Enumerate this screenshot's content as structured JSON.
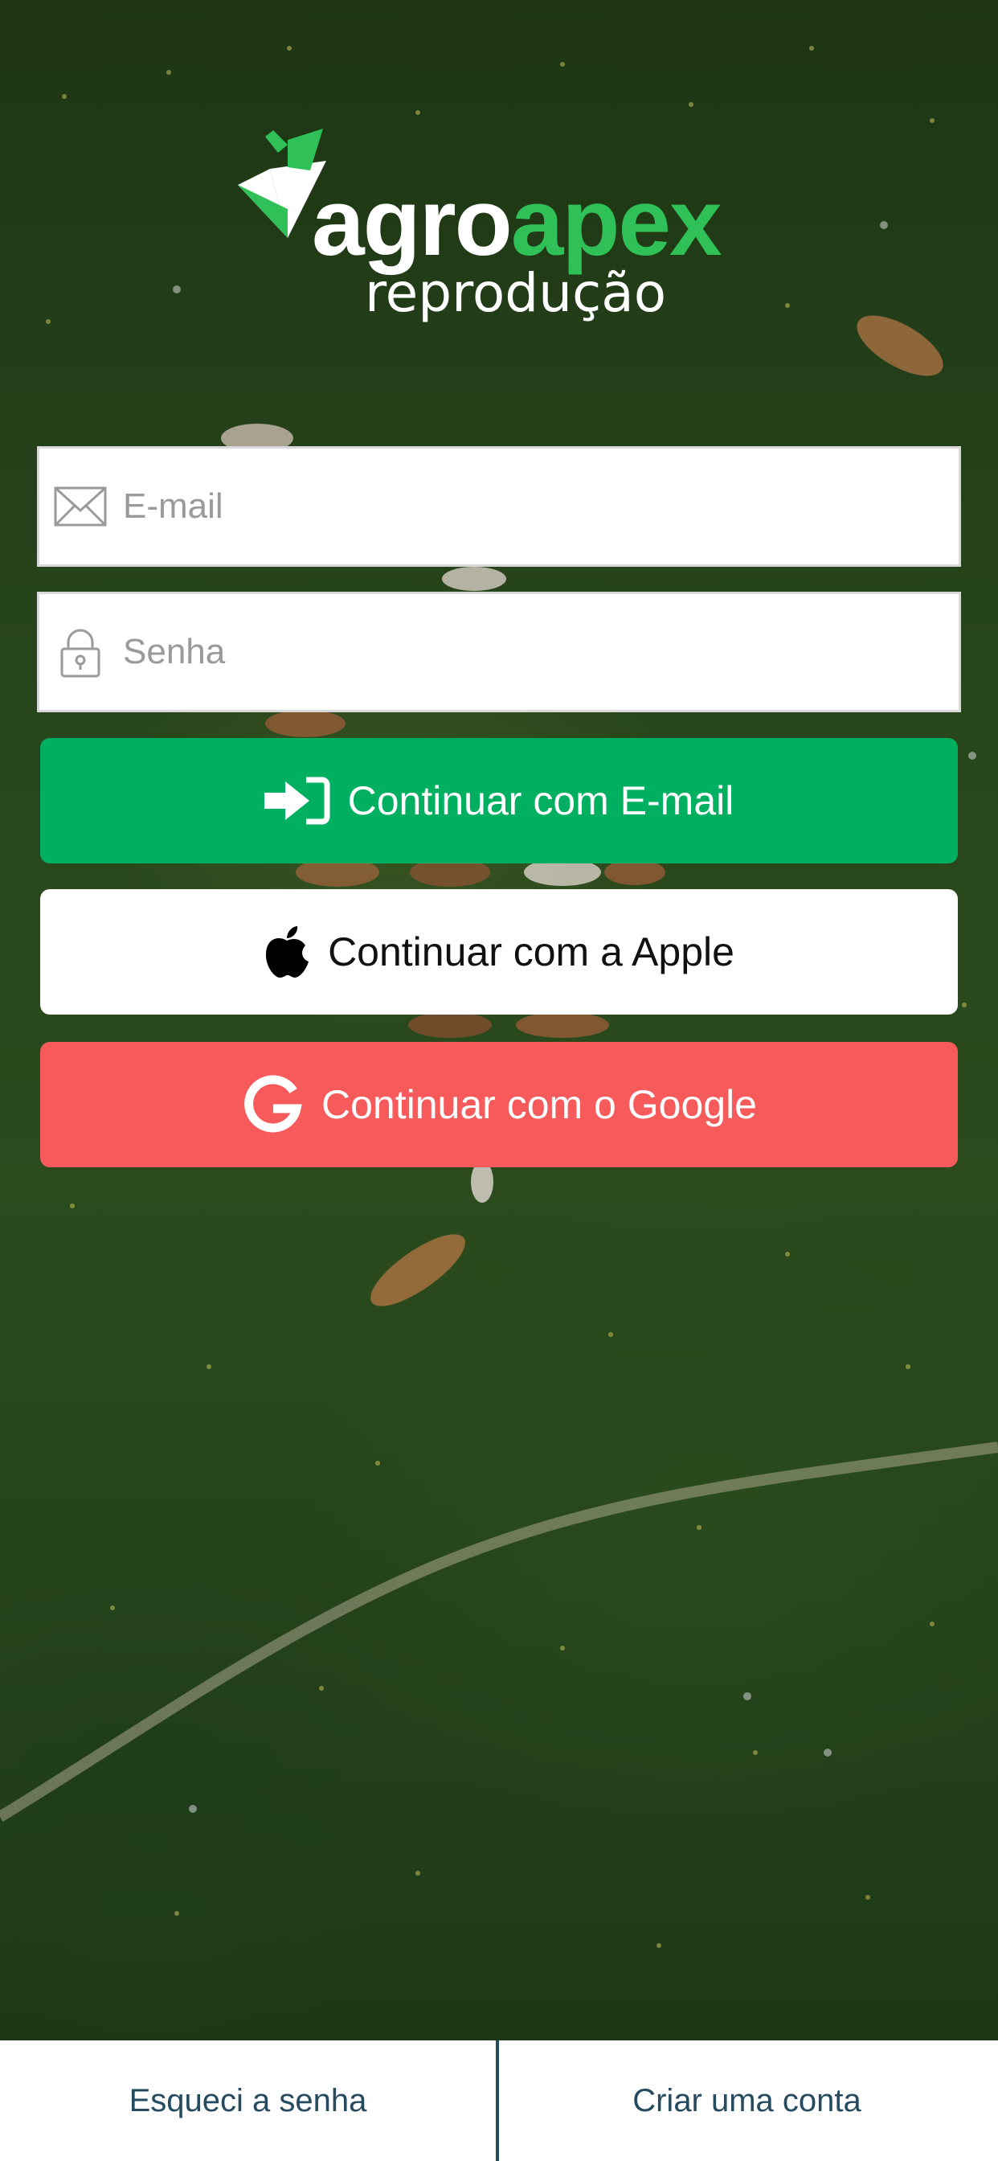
{
  "app": {
    "brand_part1": "agro",
    "brand_part2": "apex",
    "subtitle": "reprodução"
  },
  "form": {
    "email_placeholder": "E-mail",
    "email_value": "",
    "password_placeholder": "Senha",
    "password_value": ""
  },
  "buttons": {
    "email_label": "Continuar com E-mail",
    "apple_label": "Continuar com a Apple",
    "google_label": "Continuar com o Google"
  },
  "footer": {
    "forgot_label": "Esqueci a senha",
    "create_label": "Criar uma conta"
  },
  "icons": {
    "email": "envelope-icon",
    "password": "lock-icon",
    "login": "login-arrow-icon",
    "apple": "apple-icon",
    "google": "google-icon"
  },
  "colors": {
    "brand_green": "#2fc157",
    "email_button": "#00b060",
    "google_button": "#f65a5b",
    "footer_text": "#264a5e"
  }
}
